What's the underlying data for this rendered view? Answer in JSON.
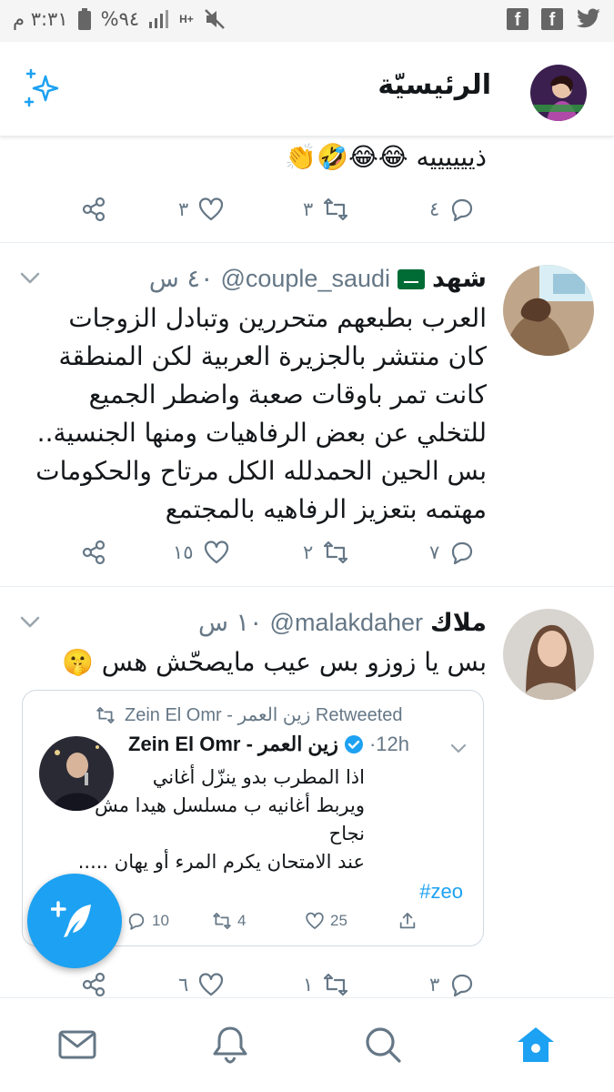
{
  "status_bar": {
    "time": "٣:٣١ م",
    "battery": "%٩٤",
    "network": "H+"
  },
  "header": {
    "title": "الرئيسيّة"
  },
  "tweets": [
    {
      "text": "ذييييييه 😂😂🤣👏",
      "actions": {
        "reply": "٤",
        "retweet": "٣",
        "like": "٣"
      }
    },
    {
      "name": "شهد",
      "handle": "@couple_saudi",
      "time": "٤٠ س",
      "text": "العرب بطبعهم متحررين وتبادل الزوجات كان منتشر بالجزيرة العربية لكن المنطقة كانت تمر باوقات صعبة واضطر الجميع للتخلي عن بعض الرفاهيات ومنها الجنسية.. بس الحين الحمدلله الكل مرتاح والحكومات مهتمه بتعزيز الرفاهيه بالمجتمع",
      "actions": {
        "reply": "٧",
        "retweet": "٢",
        "like": "١٥"
      }
    },
    {
      "name": "ملاك",
      "handle": "@malakdaher",
      "time": "١٠ س",
      "text": "بس يا زوزو بس عيب مايصحّش هس 🤫",
      "quote": {
        "retweeted_by": "Zein El Omr - زين العمر Retweeted",
        "name": "Zein El Omr - زين العمر",
        "time": "12h",
        "text_lines": [
          "اذا المطرب بدو ينزّل أغاني",
          "ويربط أغانيه ب مسلسل هيدا مش",
          "نجاح",
          "عند الامتحان يكرم المرء أو يهان ....."
        ],
        "hashtag": "#zeo",
        "actions": {
          "reply": "10",
          "retweet": "4",
          "like": "25"
        }
      },
      "actions": {
        "reply": "٣",
        "retweet": "١",
        "like": "٦"
      }
    }
  ],
  "colors": {
    "accent": "#1da1f2",
    "secondary_text": "#657786",
    "border": "#e6ecf0"
  },
  "bottom_nav": {
    "items": [
      "mail-icon",
      "bell-icon",
      "search-icon",
      "home-icon"
    ],
    "active": "home-icon"
  }
}
